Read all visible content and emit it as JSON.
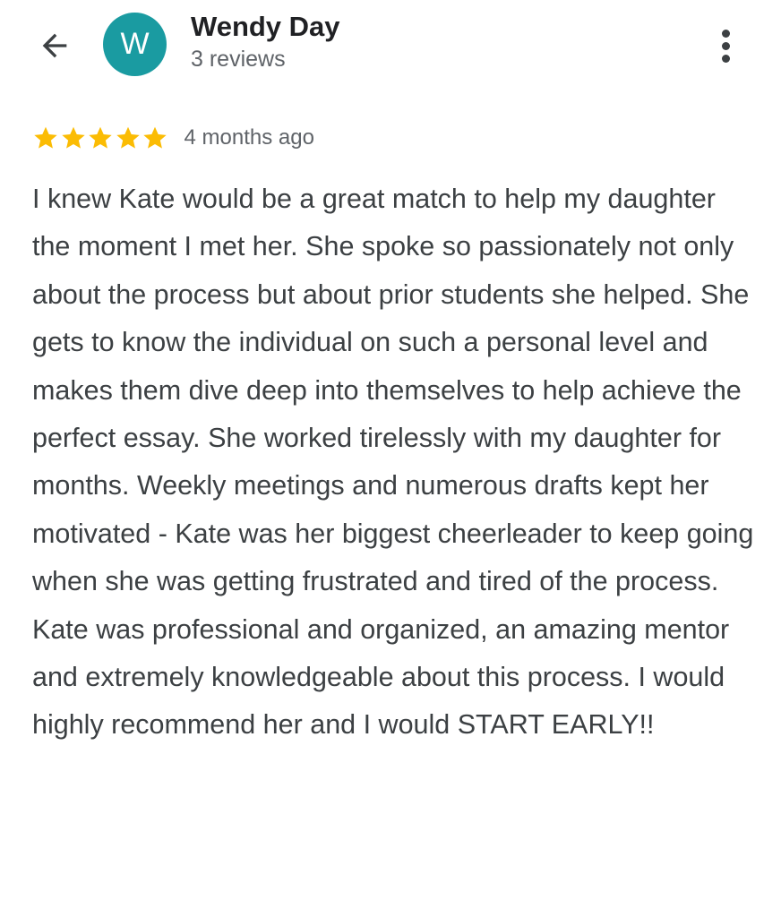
{
  "colors": {
    "avatar_bg": "#1a9ba1",
    "star": "#fbbc04",
    "name_text": "#202124",
    "secondary_text": "#5f6368",
    "body_text": "#3c4043"
  },
  "header": {
    "back_icon": "arrow-left-icon",
    "avatar_letter": "W",
    "reviewer_name": "Wendy Day",
    "review_count": "3 reviews",
    "more_icon": "more-vertical-icon"
  },
  "review": {
    "rating": 5,
    "rating_max": 5,
    "date": "4 months ago",
    "text": "I knew Kate would be a great match to help my daughter the moment I met her. She spoke so passionately not only about the process but about prior students she helped. She gets to know the individual on such a personal level and makes them dive deep into themselves to help achieve the perfect essay. She worked tirelessly with my daughter for months. Weekly meetings and numerous drafts kept her motivated - Kate was her biggest cheerleader to keep going when she was getting frustrated and tired of the process. Kate was professional and organized, an amazing mentor and extremely knowledgeable about this process. I would highly recommend her and I would START EARLY!!"
  }
}
